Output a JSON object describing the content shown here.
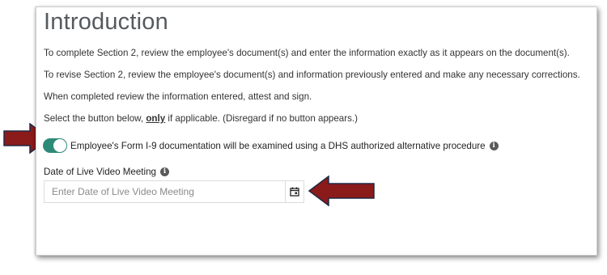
{
  "page": {
    "title": "Introduction",
    "paragraphs": {
      "p1": "To complete Section 2, review the employee's document(s) and enter the information exactly as it appears on the document(s).",
      "p2": "To revise Section 2, review the employee's document(s) and information previously entered and make any necessary corrections.",
      "p3": "When completed review the information entered, attest and sign.",
      "p4_before": "Select the button below, ",
      "p4_emphasis": "only",
      "p4_after": " if applicable. (Disregard if no button appears.)"
    }
  },
  "alt_procedure": {
    "label": "Employee's Form I-9 documentation will be examined using a DHS authorized alternative procedure",
    "toggle_on": true,
    "toggle_color": "#2e8a78"
  },
  "video_meeting": {
    "label": "Date of Live Video Meeting",
    "placeholder": "Enter Date of Live Video Meeting",
    "value": ""
  },
  "icons": {
    "info": "info-icon",
    "calendar": "calendar-icon",
    "info_glyph": "i"
  },
  "annotations": {
    "arrow_color": "#8b1a1a"
  }
}
